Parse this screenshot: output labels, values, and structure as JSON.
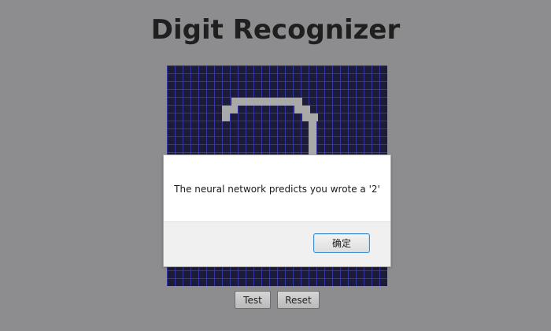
{
  "app": {
    "title": "Digit Recognizer"
  },
  "buttons": {
    "test_label": "Test",
    "reset_label": "Reset"
  },
  "dialog": {
    "message": "The neural network predicts you wrote a '2'",
    "ok_label": "确定"
  },
  "colors": {
    "background": "#8d8d8f",
    "canvas": "#1c1c38",
    "grid_lines": "#3c3cc8",
    "drawn_pixel": "#a9a9aa"
  }
}
